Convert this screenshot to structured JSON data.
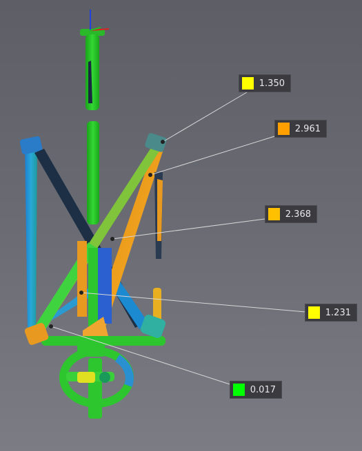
{
  "scene": {
    "axis_colors": {
      "x": "#e02020",
      "y": "#20c020",
      "z": "#2040e0"
    }
  },
  "annotations": [
    {
      "value": "1.350",
      "color": "#ffff00"
    },
    {
      "value": "2.961",
      "color": "#ff9f00"
    },
    {
      "value": "2.368",
      "color": "#ffc000"
    },
    {
      "value": "1.231",
      "color": "#ffff00"
    },
    {
      "value": "0.017",
      "color": "#00ff00"
    }
  ]
}
